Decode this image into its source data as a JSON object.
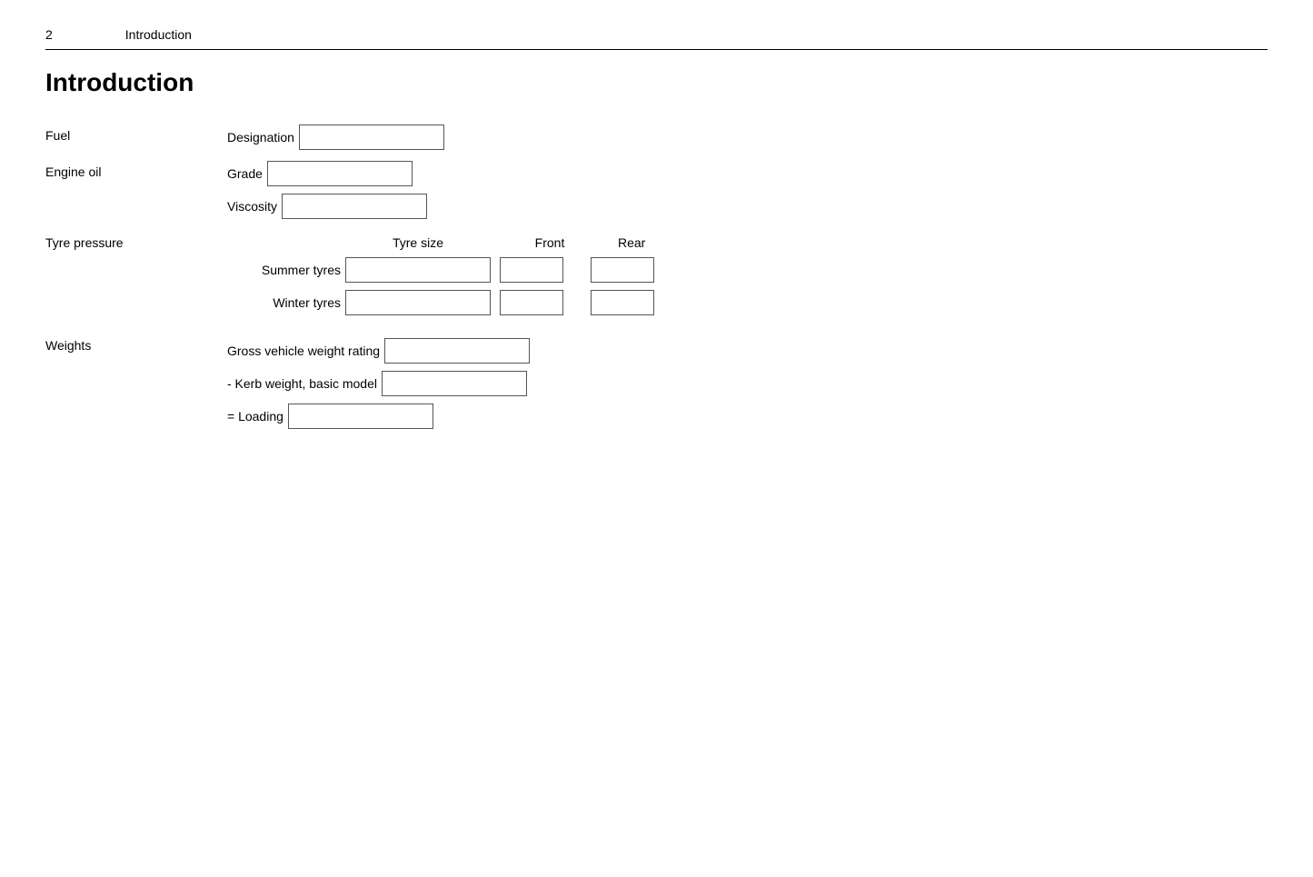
{
  "header": {
    "page_number": "2",
    "title": "Introduction"
  },
  "page_title": "Introduction",
  "sections": {
    "fuel": {
      "label": "Fuel",
      "fields": [
        {
          "label": "Designation",
          "id": "fuel-designation"
        }
      ]
    },
    "engine_oil": {
      "label": "Engine oil",
      "fields": [
        {
          "label": "Grade",
          "id": "engine-oil-grade"
        },
        {
          "label": "Viscosity",
          "id": "engine-oil-viscosity"
        }
      ]
    },
    "tyre_pressure": {
      "label": "Tyre pressure",
      "column_headers": {
        "tyre_size": "Tyre size",
        "front": "Front",
        "rear": "Rear"
      },
      "rows": [
        {
          "label": "Summer tyres",
          "id_size": "summer-tyre-size",
          "id_front": "summer-front",
          "id_rear": "summer-rear"
        },
        {
          "label": "Winter tyres",
          "id_size": "winter-tyre-size",
          "id_front": "winter-front",
          "id_rear": "winter-rear"
        }
      ]
    },
    "weights": {
      "label": "Weights",
      "fields": [
        {
          "label": "Gross vehicle weight rating",
          "id": "gross-weight"
        },
        {
          "label": "- Kerb weight, basic model",
          "id": "kerb-weight"
        },
        {
          "label": "= Loading",
          "id": "loading"
        }
      ]
    }
  }
}
